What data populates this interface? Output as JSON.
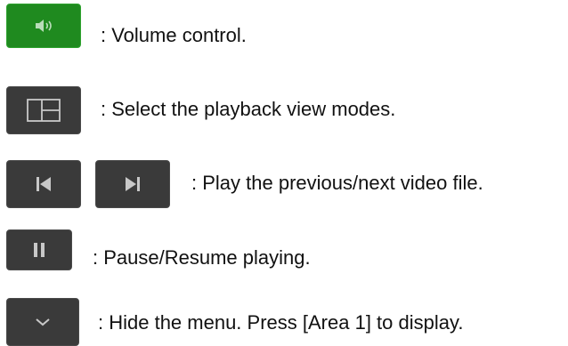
{
  "items": [
    {
      "icon": "volume-icon",
      "color": "#1f8a1f",
      "description": ": Volume control."
    },
    {
      "icon": "view-modes-icon",
      "color": "#3a3a3a",
      "description": ": Select the playback view modes."
    },
    {
      "icons": [
        "previous-file-icon",
        "next-file-icon"
      ],
      "color": "#3a3a3a",
      "description": ": Play the previous/next video file."
    },
    {
      "icon": "pause-icon",
      "color": "#3a3a3a",
      "description": ": Pause/Resume playing."
    },
    {
      "icon": "chevron-down-icon",
      "color": "#3a3a3a",
      "description": ": Hide the menu. Press [Area 1] to display."
    }
  ]
}
